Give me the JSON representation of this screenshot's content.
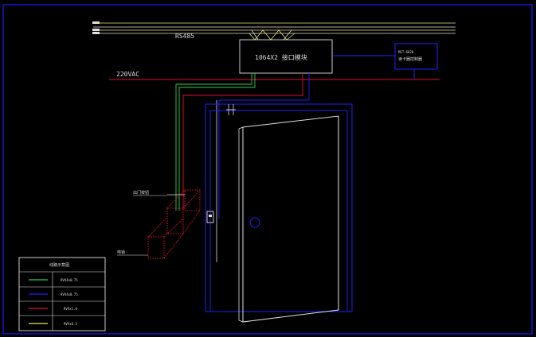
{
  "colors": {
    "background": "#000000",
    "frame_blue": "#1a1aff",
    "bus_yellow": "#e8e860",
    "bus_white": "#e0e0e0",
    "power_red": "#e01030",
    "wire_green": "#30d040",
    "wire_blue": "#2020ff",
    "box_white": "#e0e0e0",
    "box_blue": "#2020ff",
    "outline_red": "#e01020"
  },
  "labels": {
    "bus": "RS485",
    "power": "220VAC",
    "module": "1064X2 接口模块",
    "reader_box_line1": "MST-6020",
    "reader_box_line2": "读卡器控制器",
    "top_right_1": "",
    "top_right_2": ""
  },
  "legend": {
    "title": "线路示意图",
    "items": [
      {
        "label": "RVV4x0.75",
        "color": "#30d040",
        "icon": "green-line"
      },
      {
        "label": "RVV4x0.75",
        "color": "#2020ff",
        "icon": "blue-line"
      },
      {
        "label": "RVVx1.0",
        "color": "#e01030",
        "icon": "red-line"
      },
      {
        "label": "RVVx0.5",
        "color": "#e8e860",
        "icon": "yellow-line"
      }
    ]
  },
  "device_labels": {
    "exit_button": "出门按钮",
    "lock": "电锁"
  }
}
